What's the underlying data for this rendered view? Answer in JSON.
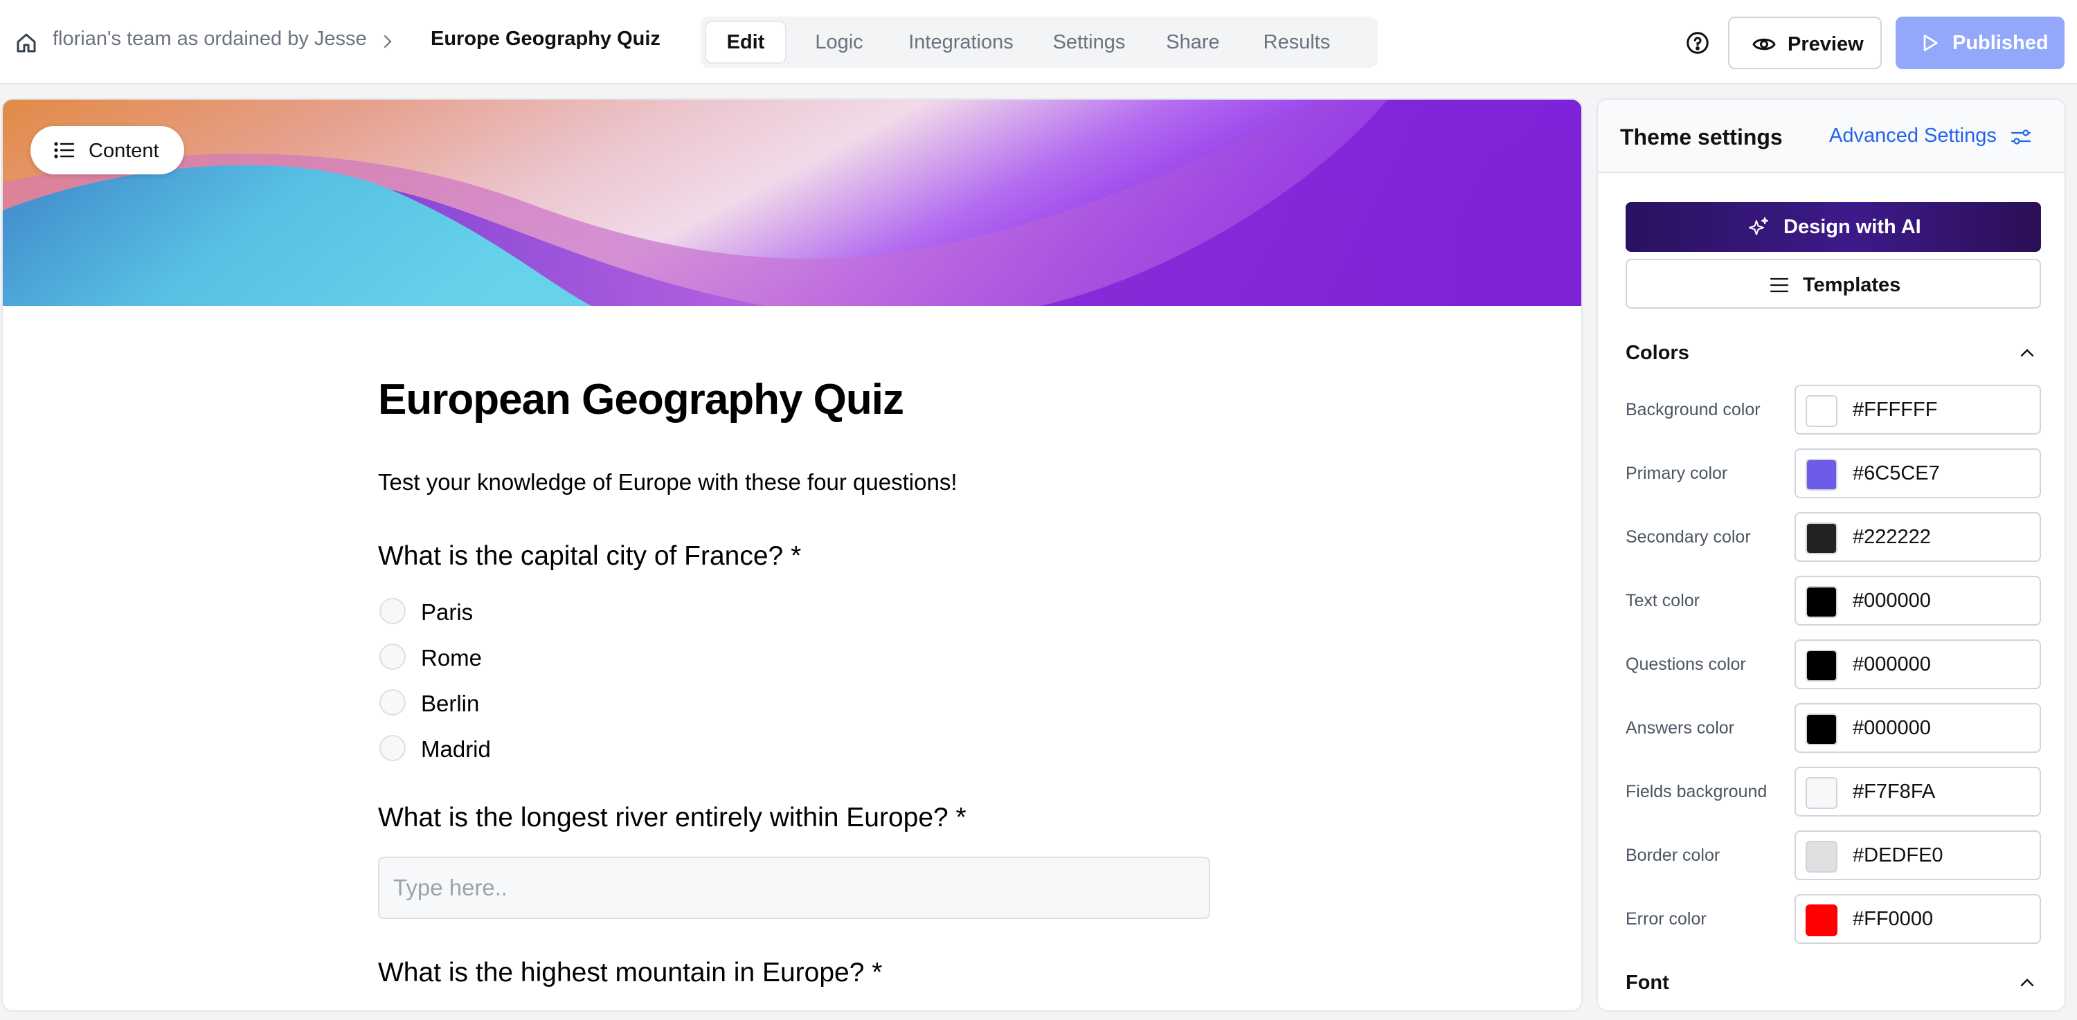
{
  "header": {
    "team": "florian's team as ordained by Jesse",
    "form_name": "Europe Geography Quiz",
    "tabs": [
      {
        "label": "Edit"
      },
      {
        "label": "Logic"
      },
      {
        "label": "Integrations"
      },
      {
        "label": "Settings"
      },
      {
        "label": "Share"
      },
      {
        "label": "Results"
      }
    ],
    "preview_label": "Preview",
    "publish_label": "Published",
    "icons": [
      "home-icon",
      "chevron-right-icon",
      "help-icon",
      "eye-icon",
      "play-icon"
    ]
  },
  "main": {
    "content_button": "Content",
    "title": "European Geography Quiz",
    "description": "Test your knowledge of Europe with these four questions!",
    "questions": [
      {
        "label": "What is the capital city of France? *",
        "options": [
          "Paris",
          "Rome",
          "Berlin",
          "Madrid"
        ]
      },
      {
        "label": "What is the longest river entirely within Europe? *",
        "placeholder": "Type here.."
      },
      {
        "label": "What is the highest mountain in Europe? *"
      }
    ]
  },
  "theme": {
    "title": "Theme settings",
    "advanced_link": "Advanced Settings",
    "ai_button": "Design with AI",
    "templates_button": "Templates",
    "colors_section": "Colors",
    "font_section": "Font",
    "colors": [
      {
        "name": "Background color",
        "hex": "#FFFFFF"
      },
      {
        "name": "Primary color",
        "hex": "#6C5CE7"
      },
      {
        "name": "Secondary color",
        "hex": "#222222"
      },
      {
        "name": "Text color",
        "hex": "#000000"
      },
      {
        "name": "Questions color",
        "hex": "#000000"
      },
      {
        "name": "Answers color",
        "hex": "#000000"
      },
      {
        "name": "Fields background",
        "hex": "#F7F8FA"
      },
      {
        "name": "Border color",
        "hex": "#DEDFE0"
      },
      {
        "name": "Error color",
        "hex": "#FF0000"
      }
    ]
  },
  "style": {
    "accent": "#93A8FA",
    "link": "#2563EB",
    "primary": "#6C5CE7"
  }
}
